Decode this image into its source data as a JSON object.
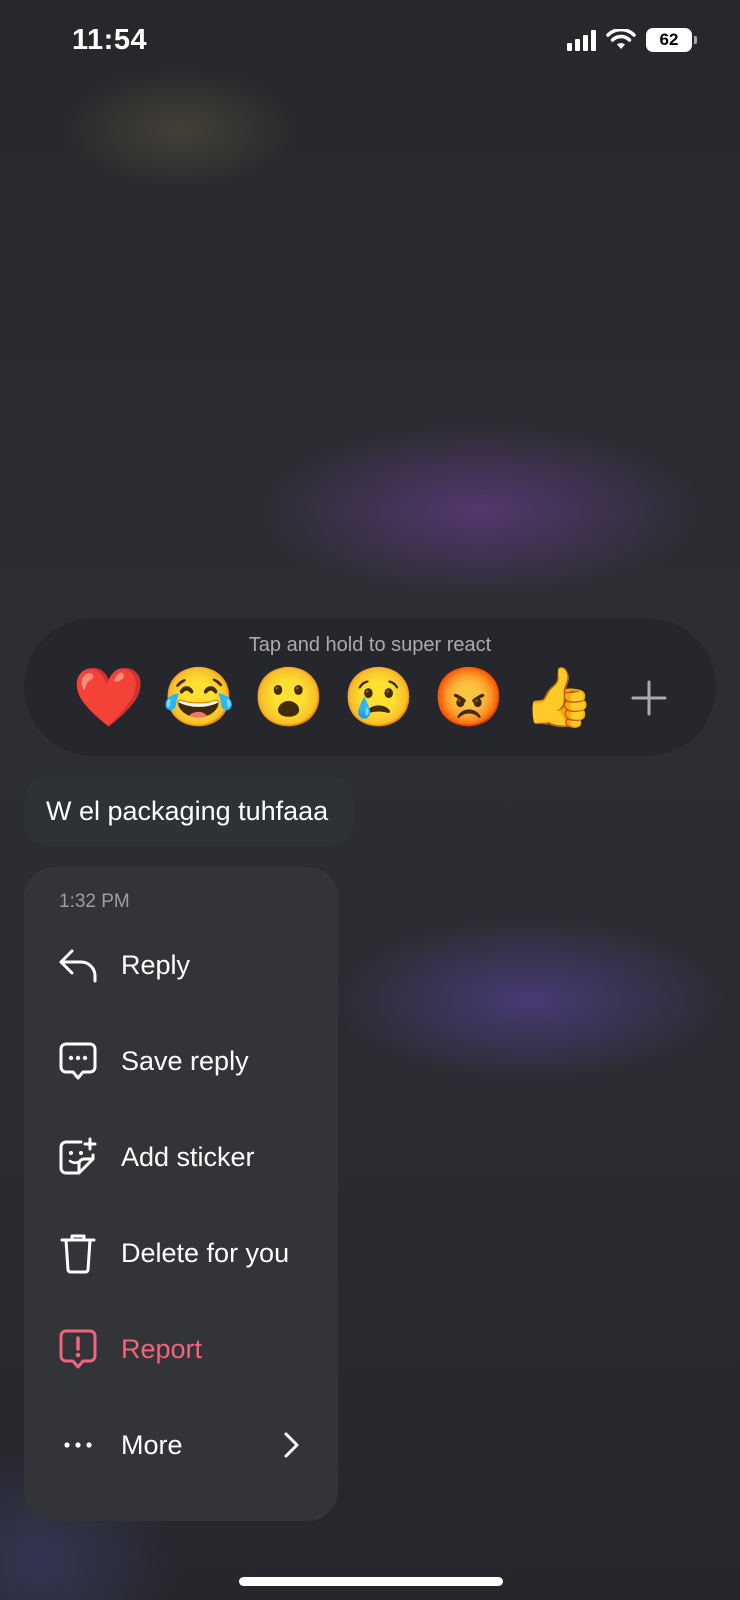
{
  "status_bar": {
    "time": "11:54",
    "battery": "62"
  },
  "reaction_bar": {
    "hint": "Tap and hold to super react",
    "emojis": [
      {
        "glyph": "❤️",
        "icon": "red-heart-icon"
      },
      {
        "glyph": "😂",
        "icon": "tears-of-joy-icon"
      },
      {
        "glyph": "😮",
        "icon": "surprised-face-icon"
      },
      {
        "glyph": "😢",
        "icon": "crying-face-icon"
      },
      {
        "glyph": "😡",
        "icon": "angry-face-icon"
      },
      {
        "glyph": "👍",
        "icon": "thumbs-up-icon"
      }
    ],
    "more_icon": "plus-icon"
  },
  "message": {
    "text": "W el packaging tuhfaaa"
  },
  "menu": {
    "time": "1:32 PM",
    "items": [
      {
        "label": "Reply",
        "icon": "reply-arrow-icon"
      },
      {
        "label": "Save reply",
        "icon": "chat-bubble-dots-icon"
      },
      {
        "label": "Add sticker",
        "icon": "sticker-plus-icon"
      },
      {
        "label": "Delete for you",
        "icon": "trash-icon"
      },
      {
        "label": "Report",
        "icon": "report-alert-icon",
        "color": "#f1657d"
      },
      {
        "label": "More",
        "icon": "more-dots-icon"
      }
    ]
  },
  "colors": {
    "danger": "#f1657d",
    "menu_bg": "#333438",
    "muted_text": "#9c9ea3"
  }
}
